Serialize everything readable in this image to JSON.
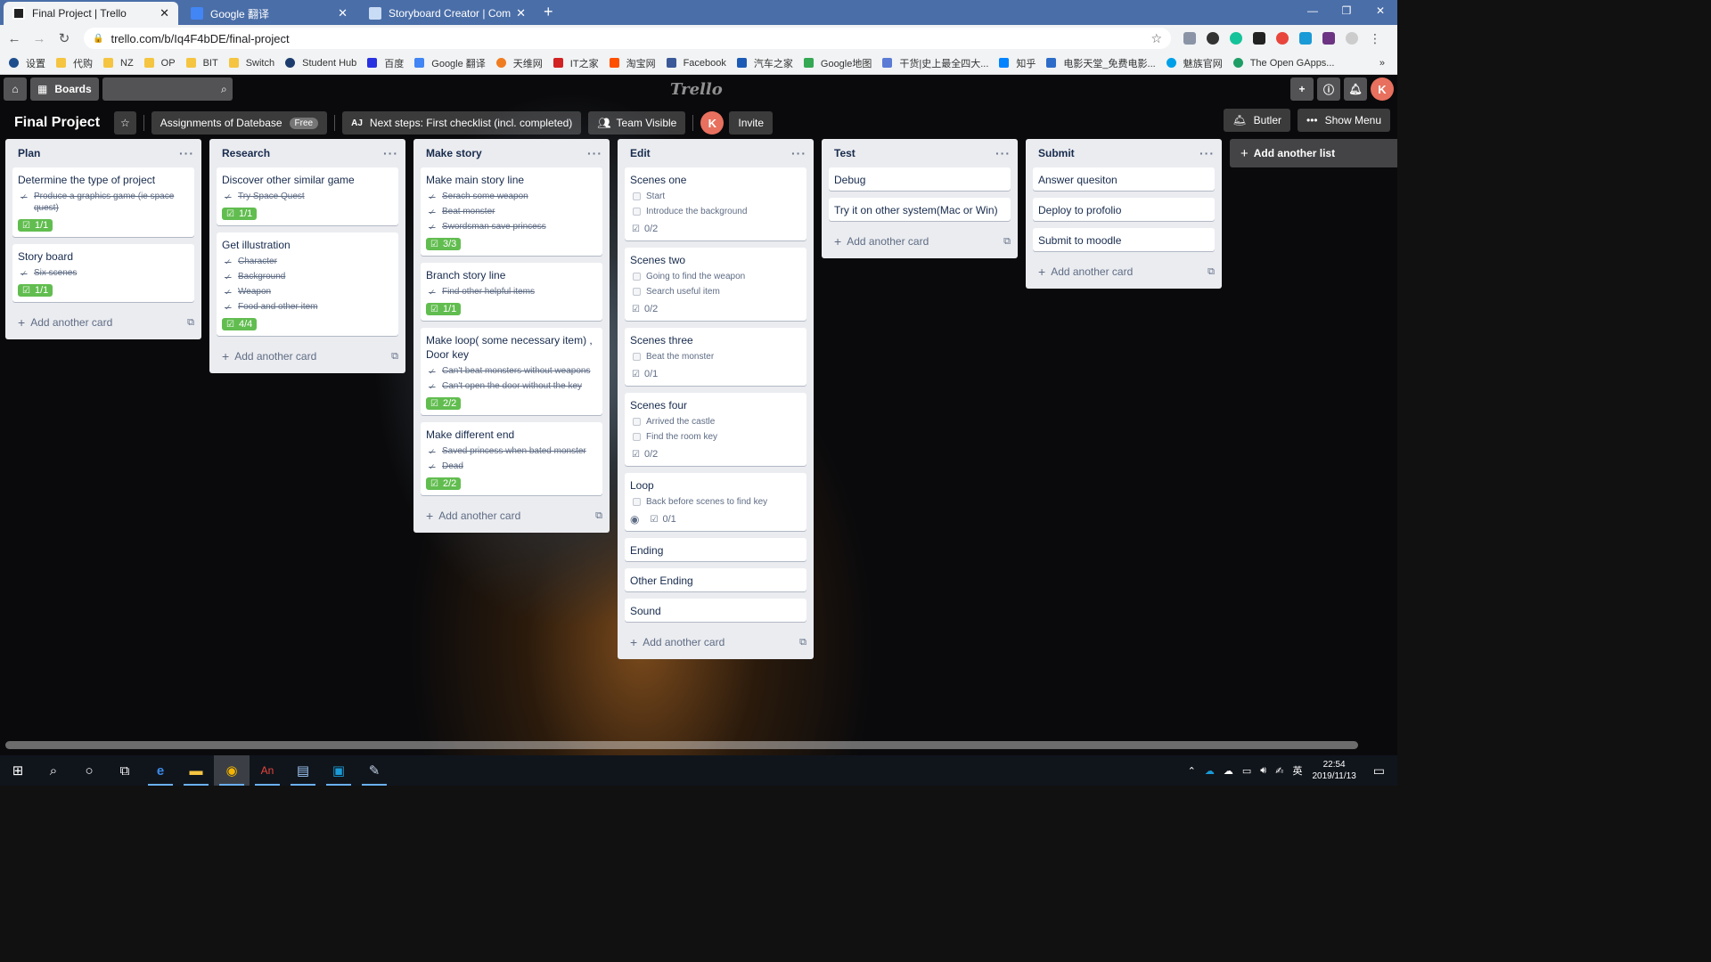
{
  "browser": {
    "tabs": [
      {
        "title": "Final Project | Trello",
        "active": true
      },
      {
        "title": "Google 翻译",
        "active": false
      },
      {
        "title": "Storyboard Creator | Comic St",
        "active": false
      }
    ],
    "url": "trello.com/b/Iq4F4bDE/final-project",
    "bookmarks": [
      "设置",
      "代购",
      "NZ",
      "OP",
      "BIT",
      "Switch",
      "Student Hub",
      "百度",
      "Google 翻译",
      "天维网",
      "IT之家",
      "淘宝网",
      "Facebook",
      "汽车之家",
      "Google地图",
      "干货|史上最全四大...",
      "知乎",
      "电影天堂_免费电影...",
      "魅族官网",
      "The Open GApps..."
    ],
    "bookmarks_more": "»"
  },
  "header": {
    "boards_label": "Boards",
    "logo_text": "Trello",
    "avatar_initial": "K"
  },
  "board": {
    "title": "Final Project",
    "team_name": "Assignments of Datebase",
    "team_plan": "Free",
    "aj_initials": "AJ",
    "next_steps": "Next steps: First checklist (incl. completed)",
    "visibility": "Team Visible",
    "invite": "Invite",
    "butler": "Butler",
    "show_menu": "Show Menu",
    "add_list": "Add another list",
    "add_card": "Add another card"
  },
  "lists": [
    {
      "name": "Plan",
      "cards": [
        {
          "title": "Determine the type of project",
          "items": [
            {
              "text": "Produce a graphics game (ie space quest)",
              "done": true
            }
          ],
          "badge": "1/1",
          "complete": true
        },
        {
          "title": "Story board",
          "items": [
            {
              "text": "Six scenes",
              "done": true
            }
          ],
          "badge": "1/1",
          "complete": true
        }
      ]
    },
    {
      "name": "Research",
      "cards": [
        {
          "title": "Discover other similar game",
          "items": [
            {
              "text": "Try Space Quest",
              "done": true
            }
          ],
          "badge": "1/1",
          "complete": true
        },
        {
          "title": "Get illustration",
          "items": [
            {
              "text": "Character",
              "done": true
            },
            {
              "text": "Background",
              "done": true
            },
            {
              "text": "Weapon",
              "done": true
            },
            {
              "text": "Food and other item",
              "done": true
            }
          ],
          "badge": "4/4",
          "complete": true
        }
      ]
    },
    {
      "name": "Make story",
      "cards": [
        {
          "title": "Make main story line",
          "items": [
            {
              "text": "Serach some weapon",
              "done": true
            },
            {
              "text": "Beat monster",
              "done": true
            },
            {
              "text": "Swordsman save princess",
              "done": true
            }
          ],
          "badge": "3/3",
          "complete": true
        },
        {
          "title": "Branch story line",
          "items": [
            {
              "text": "Find other helpful items",
              "done": true
            }
          ],
          "badge": "1/1",
          "complete": true
        },
        {
          "title": "Make loop( some necessary item) , Door key",
          "items": [
            {
              "text": "Can't beat monsters without weapons",
              "done": true
            },
            {
              "text": "Can't open the door without the key",
              "done": true
            }
          ],
          "badge": "2/2",
          "complete": true
        },
        {
          "title": "Make different end",
          "items": [
            {
              "text": "Saved princess when bated monster",
              "done": true
            },
            {
              "text": "Dead",
              "done": true
            }
          ],
          "badge": "2/2",
          "complete": true
        }
      ]
    },
    {
      "name": "Edit",
      "cards": [
        {
          "title": "Scenes one",
          "items": [
            {
              "text": "Start",
              "done": false
            },
            {
              "text": "Introduce the background",
              "done": false
            }
          ],
          "badge": "0/2",
          "complete": false
        },
        {
          "title": "Scenes two",
          "items": [
            {
              "text": "Going to find the weapon",
              "done": false
            },
            {
              "text": "Search useful item",
              "done": false
            }
          ],
          "badge": "0/2",
          "complete": false
        },
        {
          "title": "Scenes three",
          "items": [
            {
              "text": "Beat the monster",
              "done": false
            }
          ],
          "badge": "0/1",
          "complete": false
        },
        {
          "title": "Scenes four",
          "items": [
            {
              "text": "Arrived the castle",
              "done": false
            },
            {
              "text": "Find the room key",
              "done": false
            }
          ],
          "badge": "0/2",
          "complete": false
        },
        {
          "title": "Loop",
          "items": [
            {
              "text": "Back before scenes to find key",
              "done": false
            }
          ],
          "badge": "0/1",
          "complete": false,
          "watch": true
        },
        {
          "title": "Ending",
          "items": []
        },
        {
          "title": "Other Ending",
          "items": []
        },
        {
          "title": "Sound",
          "items": []
        }
      ]
    },
    {
      "name": "Test",
      "cards": [
        {
          "title": "Debug",
          "items": []
        },
        {
          "title": "Try it on other system(Mac or Win)",
          "items": []
        }
      ]
    },
    {
      "name": "Submit",
      "cards": [
        {
          "title": "Answer quesiton",
          "items": []
        },
        {
          "title": "Deploy to profolio",
          "items": []
        },
        {
          "title": "Submit to moodle",
          "items": []
        }
      ]
    }
  ],
  "taskbar": {
    "tray_lang": "英",
    "time": "22:54",
    "date": "2019/11/13"
  },
  "colors": {
    "complete_green": "#61bd4f",
    "list_bg": "#ebecf0",
    "chrome_blue": "#4a6ea8"
  }
}
